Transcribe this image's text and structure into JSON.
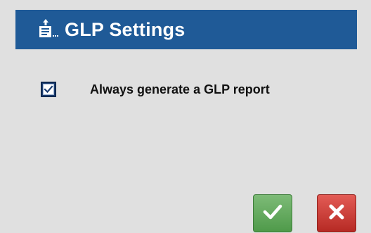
{
  "dialog": {
    "title": "GLP Settings",
    "title_icon": "export-document-icon",
    "colors": {
      "titlebar": "#1f5a97",
      "background": "#e0e0e0",
      "ok_button": "#5fa659",
      "cancel_button": "#c7352f"
    }
  },
  "options": [
    {
      "label": "Always generate a GLP report",
      "checked": true
    }
  ],
  "buttons": {
    "ok_icon": "checkmark-icon",
    "cancel_icon": "close-icon"
  }
}
